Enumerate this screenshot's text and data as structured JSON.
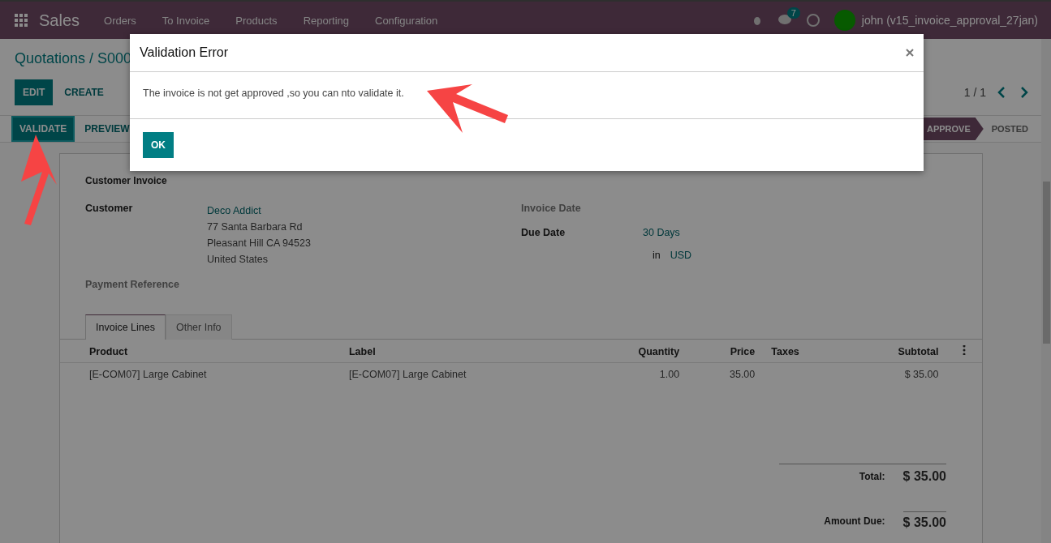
{
  "navbar": {
    "app": "Sales",
    "menu": [
      "Orders",
      "To Invoice",
      "Products",
      "Reporting",
      "Configuration"
    ],
    "message_count": "7",
    "user": "john (v15_invoice_approval_27jan)"
  },
  "breadcrumb": "Quotations / S000",
  "main_buttons": [
    {
      "label": "EDIT",
      "kind": "primary"
    },
    {
      "label": "CREATE",
      "kind": "secondary"
    }
  ],
  "pager": "1 / 1",
  "action_buttons": [
    {
      "label": "VALIDATE",
      "kind": "primary"
    },
    {
      "label": "PREVIEW",
      "kind": "secondary"
    }
  ],
  "status_steps": [
    {
      "label": "APPROVE",
      "selected": true
    },
    {
      "label": "POSTED",
      "selected": false
    }
  ],
  "sheet": {
    "title": "Customer Invoice",
    "customer": {
      "label": "Customer",
      "name": "Deco Addict",
      "address": [
        "77 Santa Barbara Rd",
        "Pleasant Hill CA 94523",
        "United States"
      ]
    },
    "payment_reference": {
      "label": "Payment Reference"
    },
    "invoice_date": {
      "label": "Invoice Date"
    },
    "due_date": {
      "label": "Due Date",
      "value": "30 Days"
    },
    "currency": {
      "prefix": "in",
      "value": "USD"
    },
    "tabs": [
      {
        "label": "Invoice Lines",
        "selected": true
      },
      {
        "label": "Other Info",
        "selected": false
      }
    ],
    "table": {
      "columns": [
        "Product",
        "Label",
        "Quantity",
        "Price",
        "Taxes",
        "Subtotal"
      ],
      "rows": [
        [
          "[E-COM07] Large Cabinet",
          "[E-COM07] Large Cabinet",
          "1.00",
          "35.00",
          "",
          "$ 35.00"
        ]
      ]
    },
    "totals": [
      {
        "label": "Total:",
        "value": "$ 35.00"
      },
      {
        "label": "Amount Due:",
        "value": "$ 35.00"
      }
    ]
  },
  "dialog": {
    "title": "Validation Error",
    "message": "The invoice is not get approved ,so you can nto validate it.",
    "button": "OK"
  }
}
